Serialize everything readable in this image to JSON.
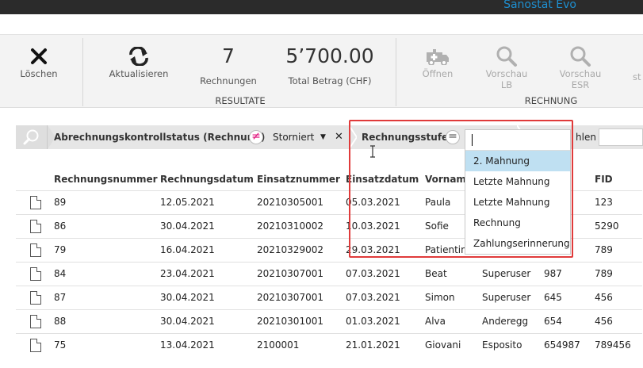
{
  "app": {
    "brand": "Sanostat Evo"
  },
  "ribbon": {
    "delete_label": "Löschen",
    "refresh_label": "Aktualisieren",
    "count_value": "7",
    "count_label": "Rechnungen",
    "total_value": "5’700.00",
    "total_label": "Total Betrag (CHF)",
    "results_group": "RESULTATE",
    "open_label": "Öffnen",
    "preview_lb_line1": "Vorschau",
    "preview_lb_line2": "LB",
    "preview_esr_line1": "Vorschau",
    "preview_esr_line2": "ESR",
    "truncated_label": "st",
    "invoice_group": "RECHNUNG"
  },
  "filters": {
    "field1": "Abrechnungskontrollstatus (Rechnung)",
    "op1": "≠",
    "value1": "Storniert",
    "field2": "Rechnungsstufe",
    "op2": "=",
    "after_text": "hlen"
  },
  "dropdown": {
    "options": [
      "2. Mahnung",
      "Letzte Mahnung",
      "Letzte Mahnung",
      "Rechnung",
      "Zahlungserinnerung"
    ],
    "selected_index": 0
  },
  "table": {
    "columns": [
      "Rechnungsnummer",
      "Rechnungsdatum",
      "Einsatznummer",
      "Einsatzdatum",
      "Vorname",
      "",
      "",
      "FID"
    ],
    "rows": [
      [
        "89",
        "12.05.2021",
        "20210305001",
        "05.03.2021",
        "Paula",
        "",
        "",
        "123"
      ],
      [
        "86",
        "30.04.2021",
        "20210310002",
        "10.03.2021",
        "Sofie",
        "",
        "",
        "5290"
      ],
      [
        "79",
        "16.04.2021",
        "20210329002",
        "29.03.2021",
        "Patientin",
        "",
        "",
        "789"
      ],
      [
        "84",
        "23.04.2021",
        "20210307001",
        "07.03.2021",
        "Beat",
        "Superuser",
        "987",
        "789"
      ],
      [
        "87",
        "30.04.2021",
        "20210307001",
        "07.03.2021",
        "Simon",
        "Superuser",
        "645",
        "456"
      ],
      [
        "88",
        "30.04.2021",
        "20210301001",
        "01.03.2021",
        "Alva",
        "Anderegg",
        "654",
        "456"
      ],
      [
        "75",
        "13.04.2021",
        "2100001",
        "21.01.2021",
        "Giovani",
        "Esposito",
        "654987",
        "789456"
      ]
    ]
  },
  "colors": {
    "accent": "#1e8fd0",
    "highlight": "#e03b3b",
    "selected": "#bfe0f2",
    "not_equal": "#e0107a"
  }
}
